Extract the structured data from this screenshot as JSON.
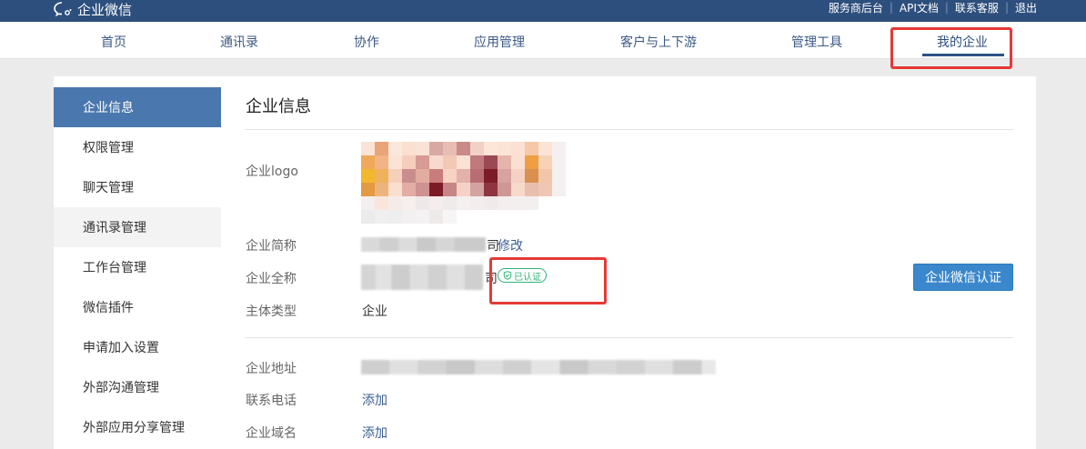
{
  "topbar": {
    "brand": "企业微信",
    "links": [
      "服务商后台",
      "API文档",
      "联系客服",
      "退出"
    ]
  },
  "nav": {
    "items": [
      "首页",
      "通讯录",
      "协作",
      "应用管理",
      "客户与上下游",
      "管理工具",
      "我的企业"
    ],
    "active": "我的企业"
  },
  "sidebar": {
    "items": [
      "企业信息",
      "权限管理",
      "聊天管理",
      "通讯录管理",
      "工作台管理",
      "微信插件",
      "申请加入设置",
      "外部沟通管理",
      "外部应用分享管理"
    ],
    "active": "企业信息"
  },
  "main": {
    "title": "企业信息",
    "logo_label": "企业logo",
    "short_name_label": "企业简称",
    "short_name_suffix": "司",
    "modify_link": "修改",
    "full_name_label": "企业全称",
    "full_name_suffix": "司",
    "verified_badge": "已认证",
    "verify_button": "企业微信认证",
    "entity_type_label": "主体类型",
    "entity_type_value": "企业",
    "address_label": "企业地址",
    "phone_label": "联系电话",
    "phone_action": "添加",
    "domain_label": "企业域名",
    "domain_action": "添加"
  },
  "colors": {
    "topbar": "#2d4f7d",
    "sidebar_active": "#4a77ae",
    "link": "#3a5f93",
    "verified_green": "#2fb37a",
    "verify_button": "#3a87cc",
    "highlight_red": "#e53935"
  }
}
